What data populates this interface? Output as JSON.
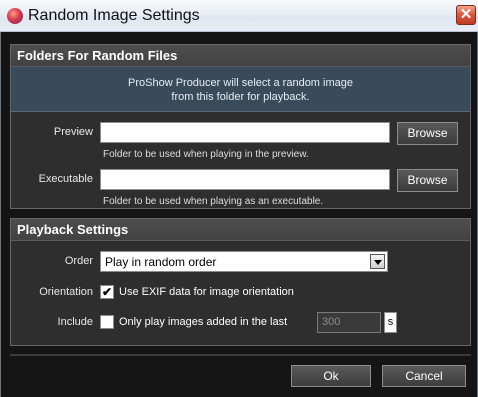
{
  "window": {
    "title": "Random Image Settings",
    "close_glyph": "✕",
    "app_icon": "proshow-app-icon"
  },
  "folders_group": {
    "title": "Folders For Random Files",
    "info_line1": "ProShow Producer will select a random image",
    "info_line2": "from this folder for playback.",
    "preview": {
      "label": "Preview",
      "value": "",
      "browse_label": "Browse",
      "hint": "Folder to be used when playing in the preview."
    },
    "executable": {
      "label": "Executable",
      "value": "",
      "browse_label": "Browse",
      "hint": "Folder to be used when playing as an executable."
    }
  },
  "playback_group": {
    "title": "Playback Settings",
    "order": {
      "label": "Order",
      "selected": "Play in random order"
    },
    "orientation": {
      "label": "Orientation",
      "checked": true,
      "check_glyph": "✔",
      "text": "Use EXIF data for image orientation"
    },
    "include": {
      "label": "Include",
      "checked": false,
      "text": "Only play images added in the last",
      "value": "300",
      "unit": "s"
    }
  },
  "footer": {
    "ok_label": "Ok",
    "cancel_label": "Cancel"
  }
}
